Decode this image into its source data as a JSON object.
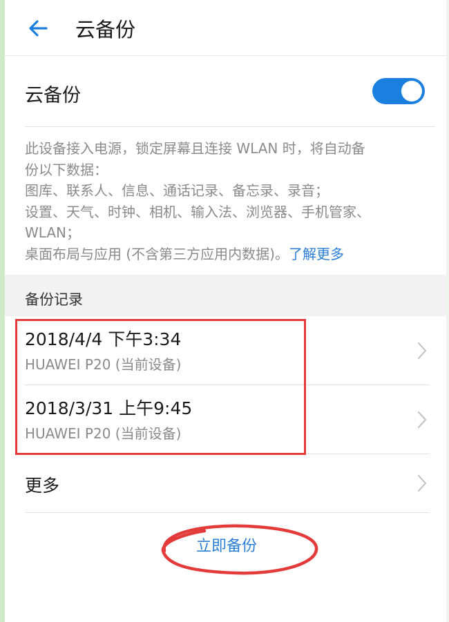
{
  "header": {
    "back_icon": "arrow-left-icon",
    "title": "云备份"
  },
  "toggle": {
    "label": "云备份",
    "on": true
  },
  "description": {
    "lines": [
      "此设备接入电源，锁定屏幕且连接 WLAN 时，将自动备",
      "份以下数据：",
      "图库、联系人、信息、通话记录、备忘录、录音；",
      "设置、天气、时钟、相机、输入法、浏览器、手机管家、",
      "WLAN；"
    ],
    "last_line": "桌面布局与应用 (不含第三方应用内数据)。",
    "learn_more": "了解更多"
  },
  "records_section": {
    "title": "备份记录"
  },
  "records": [
    {
      "title": "2018/4/4 下午3:34",
      "device": "HUAWEI P20 (当前设备)"
    },
    {
      "title": "2018/3/31 上午9:45",
      "device": "HUAWEI P20 (当前设备)"
    }
  ],
  "more": {
    "label": "更多"
  },
  "backup_now": {
    "label": "立即备份"
  },
  "colors": {
    "accent": "#1b7fe0",
    "link": "#2a7fd4",
    "highlight": "#e33a3a"
  }
}
